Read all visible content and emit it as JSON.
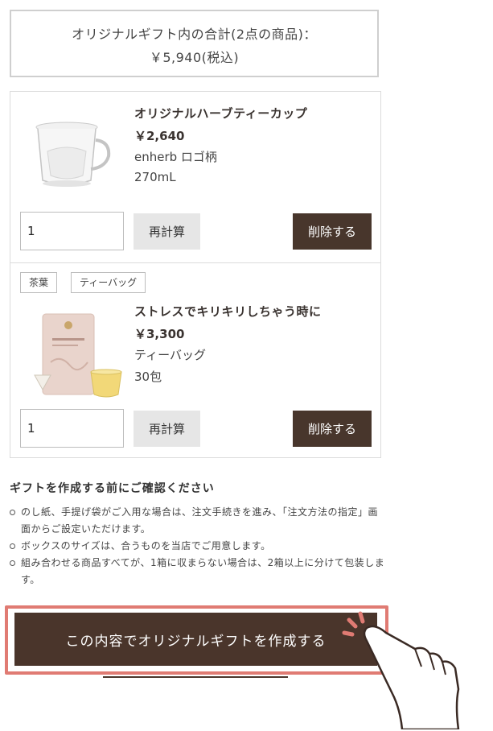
{
  "total": {
    "line1": "オリジナルギフト内の合計(2点の商品)：",
    "line2": "￥5,940(税込)"
  },
  "items": [
    {
      "name": "オリジナルハーブティーカップ",
      "price": "￥2,640",
      "detail1": "enherb ロゴ柄",
      "detail2": "270mL",
      "quantity": "1",
      "recalc_label": "再計算",
      "delete_label": "削除する",
      "tags": []
    },
    {
      "name": "ストレスでキリキリしちゃう時に",
      "price": "￥3,300",
      "detail1": "ティーバッグ",
      "detail2": "30包",
      "quantity": "1",
      "recalc_label": "再計算",
      "delete_label": "削除する",
      "tags": [
        "茶葉",
        "ティーバッグ"
      ]
    }
  ],
  "notes": {
    "title": "ギフトを作成する前にご確認ください",
    "items": [
      "のし紙、手提げ袋がご入用な場合は、注文手続きを進み、「注文方法の指定」画面からご設定いただけます。",
      "ボックスのサイズは、合うものを当店でご用意します。",
      "組み合わせる商品すべてが、1箱に収まらない場合は、2箱以上に分けて包装します。"
    ]
  },
  "cta": {
    "label": "この内容でオリジナルギフトを作成する"
  },
  "colors": {
    "brand_dark": "#48362c",
    "highlight": "#e07b73",
    "recalc_bg": "#e6e6e6"
  }
}
